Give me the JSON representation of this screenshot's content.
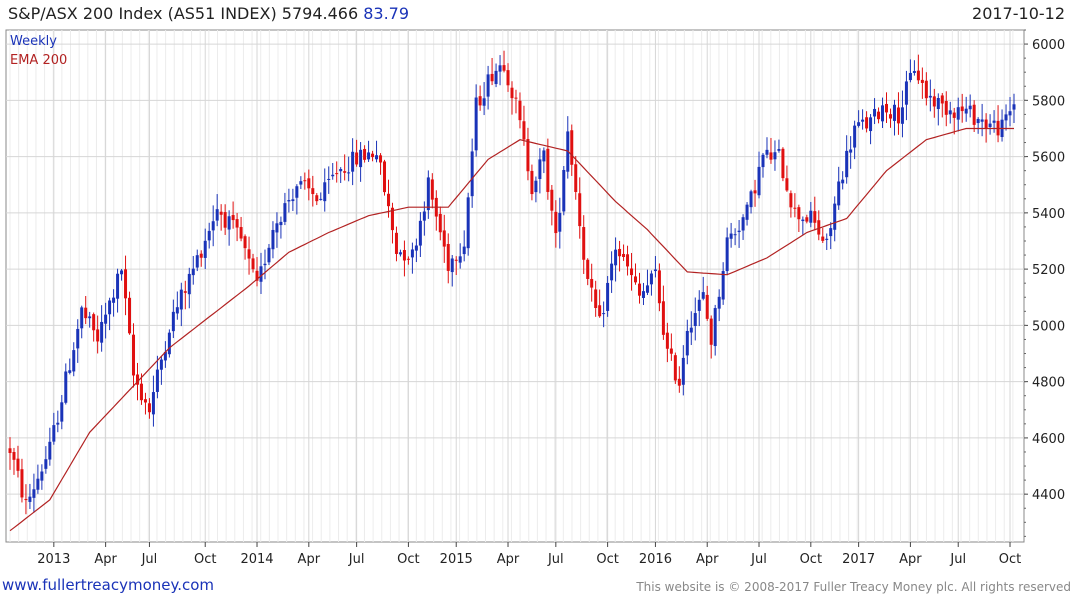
{
  "header": {
    "title_prefix": "S&P/ASX 200 Index (AS51 INDEX) 5794.466",
    "change": "83.79",
    "date": "2017-10-12"
  },
  "legend": {
    "weekly": "Weekly",
    "ema": "EMA 200"
  },
  "footer": {
    "website": "www.fullertreacymoney.com",
    "copyright": "This website is © 2008-2017 Fuller Treacy Money plc. All rights reserved"
  },
  "colors": {
    "up": "#1a33b8",
    "down": "#e01010",
    "ema": "#b22222",
    "grid": "#d6d6d6"
  },
  "chart_data": {
    "type": "candlestick",
    "title": "S&P/ASX 200 Index (AS51 INDEX) 5794.466 83.79",
    "frequency": "Weekly",
    "ylim": [
      4230,
      6050
    ],
    "y_ticks": [
      4400,
      4600,
      4800,
      5000,
      5200,
      5400,
      5600,
      5800,
      6000
    ],
    "x_ticks": [
      "2013",
      "Apr",
      "Jul",
      "Oct",
      "2014",
      "Apr",
      "Jul",
      "Oct",
      "2015",
      "Apr",
      "Jul",
      "Oct",
      "2016",
      "Apr",
      "Jul",
      "Oct",
      "2017",
      "Apr",
      "Jul",
      "Oct"
    ],
    "x_range_weeks": [
      0,
      252
    ],
    "x_tick_weeks": [
      11,
      24,
      35,
      49,
      62,
      75,
      87,
      100,
      112,
      125,
      137,
      150,
      162,
      175,
      188,
      201,
      213,
      226,
      238,
      251
    ],
    "series": [
      {
        "name": "Weekly",
        "price_path": [
          [
            0,
            4560
          ],
          [
            4,
            4360
          ],
          [
            10,
            4560
          ],
          [
            18,
            5050
          ],
          [
            22,
            4950
          ],
          [
            28,
            5200
          ],
          [
            31,
            4820
          ],
          [
            35,
            4700
          ],
          [
            40,
            5000
          ],
          [
            46,
            5200
          ],
          [
            52,
            5420
          ],
          [
            58,
            5300
          ],
          [
            62,
            5130
          ],
          [
            66,
            5350
          ],
          [
            72,
            5500
          ],
          [
            78,
            5450
          ],
          [
            82,
            5550
          ],
          [
            88,
            5600
          ],
          [
            92,
            5620
          ],
          [
            97,
            5270
          ],
          [
            101,
            5250
          ],
          [
            105,
            5500
          ],
          [
            110,
            5220
          ],
          [
            114,
            5300
          ],
          [
            117,
            5780
          ],
          [
            121,
            5900
          ],
          [
            124,
            5940
          ],
          [
            127,
            5780
          ],
          [
            131,
            5500
          ],
          [
            134,
            5600
          ],
          [
            137,
            5300
          ],
          [
            140,
            5700
          ],
          [
            145,
            5150
          ],
          [
            148,
            5000
          ],
          [
            152,
            5280
          ],
          [
            155,
            5200
          ],
          [
            158,
            5100
          ],
          [
            162,
            5180
          ],
          [
            165,
            4900
          ],
          [
            168,
            4800
          ],
          [
            170,
            5000
          ],
          [
            174,
            5100
          ],
          [
            176,
            4950
          ],
          [
            180,
            5300
          ],
          [
            185,
            5400
          ],
          [
            189,
            5600
          ],
          [
            193,
            5600
          ],
          [
            197,
            5400
          ],
          [
            201,
            5380
          ],
          [
            205,
            5280
          ],
          [
            208,
            5500
          ],
          [
            212,
            5700
          ],
          [
            216,
            5720
          ],
          [
            219,
            5780
          ],
          [
            223,
            5750
          ],
          [
            227,
            5920
          ],
          [
            230,
            5820
          ],
          [
            234,
            5780
          ],
          [
            240,
            5760
          ],
          [
            245,
            5720
          ],
          [
            249,
            5700
          ],
          [
            252,
            5790
          ]
        ]
      },
      {
        "name": "EMA 200",
        "points": [
          [
            0,
            4270
          ],
          [
            10,
            4380
          ],
          [
            20,
            4620
          ],
          [
            30,
            4770
          ],
          [
            40,
            4920
          ],
          [
            50,
            5030
          ],
          [
            60,
            5140
          ],
          [
            70,
            5260
          ],
          [
            80,
            5330
          ],
          [
            90,
            5390
          ],
          [
            100,
            5420
          ],
          [
            110,
            5420
          ],
          [
            120,
            5590
          ],
          [
            128,
            5660
          ],
          [
            140,
            5620
          ],
          [
            152,
            5440
          ],
          [
            160,
            5340
          ],
          [
            170,
            5190
          ],
          [
            180,
            5180
          ],
          [
            190,
            5240
          ],
          [
            200,
            5330
          ],
          [
            210,
            5380
          ],
          [
            220,
            5550
          ],
          [
            230,
            5660
          ],
          [
            240,
            5700
          ],
          [
            252,
            5700
          ]
        ]
      }
    ],
    "grid": true,
    "legend_position": "top-left"
  }
}
